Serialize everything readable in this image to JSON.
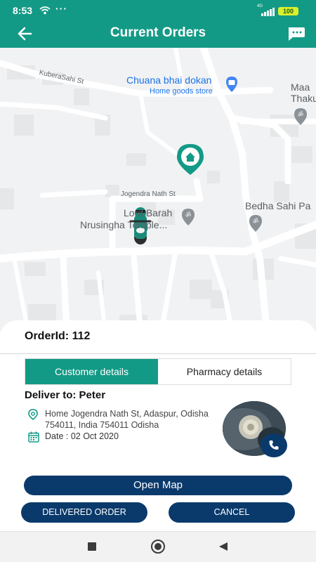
{
  "status_bar": {
    "time": "8:53",
    "dots": "···",
    "network": "4G",
    "battery": "100"
  },
  "app_bar": {
    "title": "Current Orders",
    "back_icon": "arrow-left-icon",
    "chat_icon": "chat-bubble-icon"
  },
  "map": {
    "labels": {
      "street_kuberasahi": "KuberaSahi St",
      "store_name": "Chuana bhai dokan",
      "store_type": "Home goods store",
      "maa_line1": "Maa",
      "maa_line2": "Thaku",
      "street_jogendra": "Jogendra Nath St",
      "temple_line1": "Lord Barah",
      "temple_line2": "Nrusingha Temple...",
      "bedha": "Bedha Sahi Pa"
    }
  },
  "order": {
    "id_label": "OrderId: 112",
    "tabs": [
      {
        "label": "Customer details",
        "active": true
      },
      {
        "label": "Pharmacy details",
        "active": false
      }
    ],
    "deliver_to": "Deliver to: Peter",
    "address": "Home Jogendra Nath St, Adaspur, Odisha 754011, India 754011 Odisha",
    "date": "Date : 02 Oct 2020",
    "buttons": {
      "open_map": "Open Map",
      "delivered": "DELIVERED ORDER",
      "cancel": "CANCEL"
    }
  },
  "colors": {
    "primary": "#139a86",
    "navy": "#0a3a6b"
  }
}
